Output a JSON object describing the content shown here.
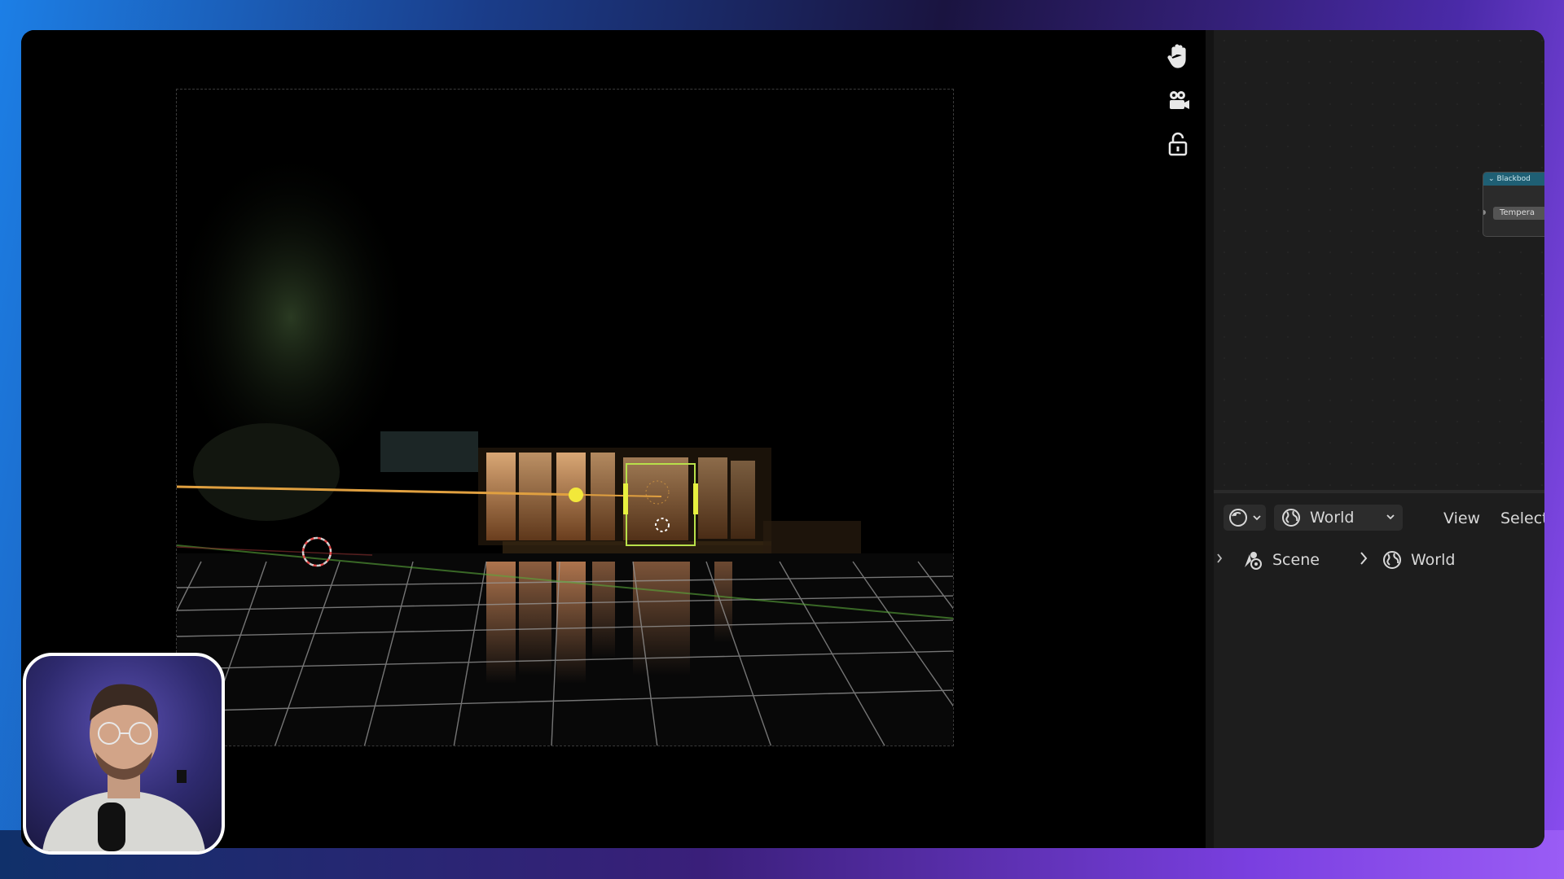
{
  "viewport": {
    "tools": [
      {
        "icon": "hand-pan-icon"
      },
      {
        "icon": "camera-view-icon"
      },
      {
        "icon": "lock-camera-icon"
      }
    ]
  },
  "node": {
    "title": "Blackbod",
    "field": "Tempera"
  },
  "header": {
    "editor_type_icon": "world-shader-icon",
    "world_select": "World",
    "menu_view": "View",
    "menu_select": "Select"
  },
  "breadcrumb": {
    "scene": "Scene",
    "world": "World"
  },
  "colors": {
    "panel_bg": "#1d1d1d",
    "widget_bg": "#2c2c2c",
    "text": "#d8d8d8",
    "light_gizmo": "#f2e83a",
    "selection": "#b8e04a"
  }
}
